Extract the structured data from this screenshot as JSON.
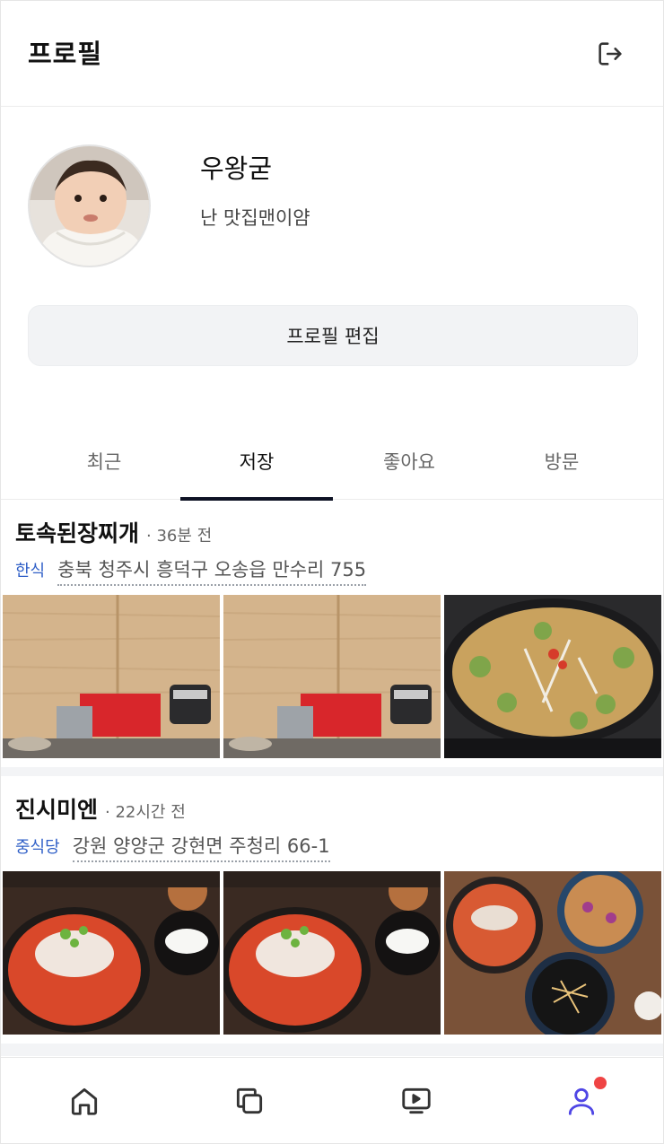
{
  "header": {
    "title": "프로필",
    "logout_icon": "logout-icon"
  },
  "profile": {
    "username": "우왕굳",
    "bio": "난 맛집맨이얌",
    "edit_label": "프로필 편집"
  },
  "tabs": [
    {
      "label": "최근",
      "active": false
    },
    {
      "label": "저장",
      "active": true
    },
    {
      "label": "좋아요",
      "active": false
    },
    {
      "label": "방문",
      "active": false
    }
  ],
  "posts": [
    {
      "name": "토속된장찌개",
      "time": "· 36분 전",
      "category": "한식",
      "address": "충북 청주시 흥덕구 오송읍 만수리 755"
    },
    {
      "name": "진시미엔",
      "time": "· 22시간 전",
      "category": "중식당",
      "address": "강원 양양군 강현면 주청리 66-1"
    }
  ],
  "bottom_nav": [
    {
      "icon": "home-icon"
    },
    {
      "icon": "copy-icon"
    },
    {
      "icon": "video-icon"
    },
    {
      "icon": "user-icon",
      "active": true,
      "badge": true
    }
  ],
  "colors": {
    "accent": "#2f5fc7",
    "active_nav": "#4f46e5",
    "tab_underline": "#0e1224",
    "badge": "#ef4444"
  }
}
